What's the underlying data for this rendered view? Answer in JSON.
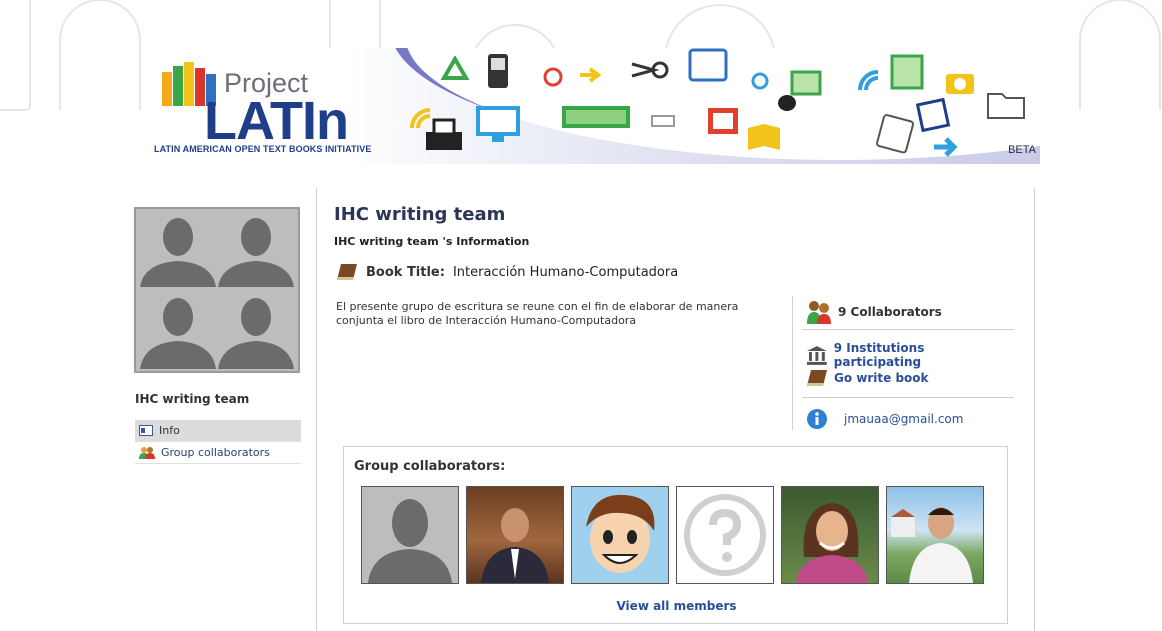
{
  "banner": {
    "project": "Project",
    "latin": "LATIn",
    "subtitle": "LATIN AMERICAN OPEN TEXT BOOKS INITIATIVE",
    "beta": "BETA"
  },
  "sidebar": {
    "group_name": "IHC writing team",
    "items": [
      {
        "label": "Info",
        "icon": "info-card-icon",
        "active": true
      },
      {
        "label": "Group collaborators",
        "icon": "people-icon",
        "active": false
      }
    ]
  },
  "main": {
    "title": "IHC writing team",
    "info_heading": "IHC writing team 's Information",
    "book_label": "Book Title:",
    "book_title": "Interacción Humano-Computadora",
    "description": "El presente grupo  de escritura se reune con el fin de elaborar de manera conjunta el libro de Interacción Humano-Computadora"
  },
  "side": {
    "collaborators": "9 Collaborators",
    "institutions": "9 Institutions participating",
    "write_book": "Go write book",
    "email": "jmauaa@gmail.com"
  },
  "collaborators": {
    "title": "Group collaborators:",
    "view_all": "View all members"
  },
  "colors": {
    "link": "#2a4e9a",
    "brand": "#1f3e8a"
  }
}
